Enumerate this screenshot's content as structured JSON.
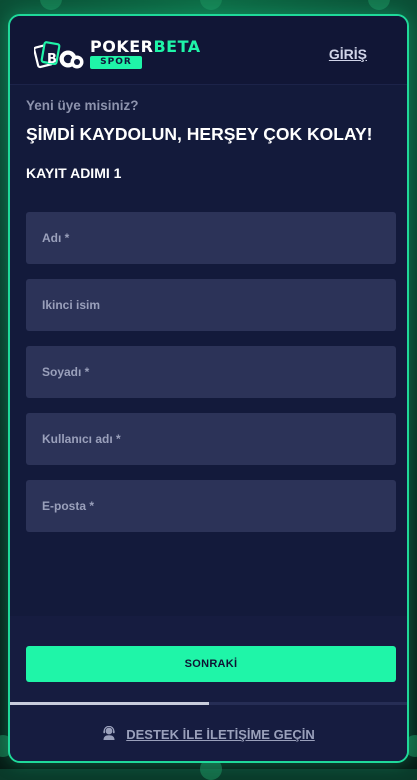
{
  "colors": {
    "accent": "#1ff5a8",
    "modal_bg": "#131a3b",
    "field_bg": "#2c3358",
    "border": "#1fd99a"
  },
  "header": {
    "logo_word_1": "POKER",
    "logo_word_2": "BETA",
    "logo_sub": "SPOR",
    "login_label": "GİRİŞ"
  },
  "intro": {
    "question": "Yeni üye misiniz?",
    "headline": "ŞİMDİ KAYDOLUN, HERŞEY ÇOK KOLAY!",
    "step_label": "KAYIT ADIMI 1"
  },
  "fields": {
    "first_name": {
      "placeholder": "Adı *",
      "value": ""
    },
    "middle_name": {
      "placeholder": "Ikinci isim",
      "value": ""
    },
    "last_name": {
      "placeholder": "Soyadı *",
      "value": ""
    },
    "username": {
      "placeholder": "Kullanıcı adı *",
      "value": ""
    },
    "email": {
      "placeholder": "E-posta *",
      "value": ""
    }
  },
  "footer": {
    "next_label": "SONRAKİ",
    "progress_fraction": 0.5,
    "support_icon": "support-agent-icon",
    "support_label": "DESTEK İLE İLETİŞİME GEÇİN"
  }
}
